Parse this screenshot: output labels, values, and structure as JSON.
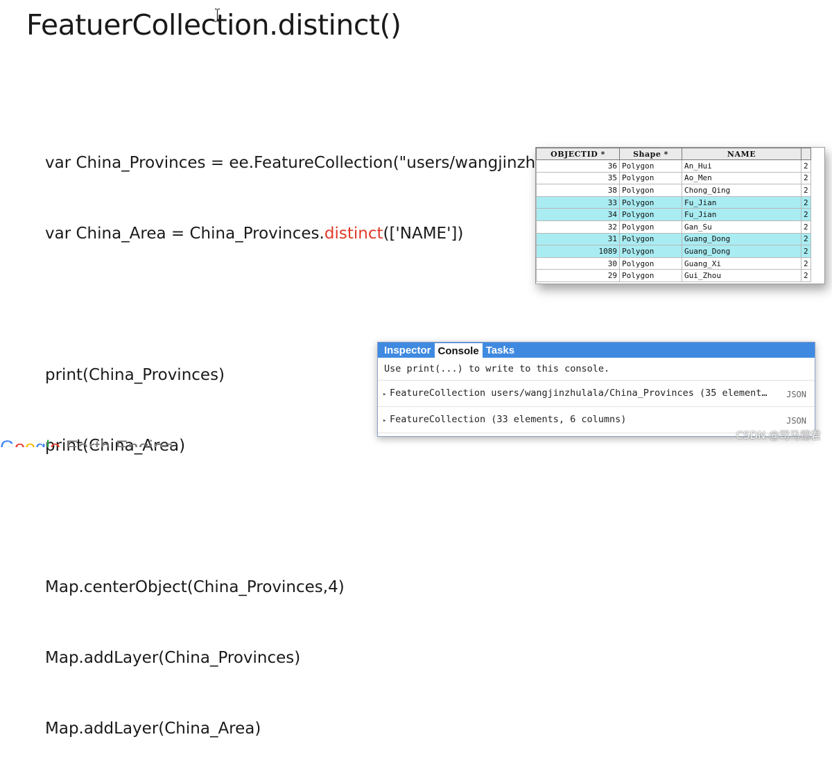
{
  "slide": {
    "title": "FeatuerCollection.distinct()"
  },
  "code": {
    "line1": "var China_Provinces = ee.FeatureCollection(\"users/wangjinzhulala/China_Provinces\");",
    "line2_pre": "var China_Area = China_Provinces.",
    "line2_hl": "distinct",
    "line2_post": "(['NAME'])",
    "line3": "print(China_Provinces)",
    "line4": "print(China_Area)",
    "line5": "Map.centerObject(China_Provinces,4)",
    "line6": "Map.addLayer(China_Provinces)",
    "line7": "Map.addLayer(China_Area)",
    "highlight_color": "#e03a2a"
  },
  "attribute_table": {
    "headers": [
      "OBJECTID *",
      "Shape *",
      "NAME",
      ""
    ],
    "rows": [
      {
        "id": "36",
        "shape": "Polygon",
        "name": "An_Hui",
        "extra": "2",
        "selected": false
      },
      {
        "id": "35",
        "shape": "Polygon",
        "name": "Ao_Men",
        "extra": "2",
        "selected": false
      },
      {
        "id": "38",
        "shape": "Polygon",
        "name": "Chong_Qing",
        "extra": "2",
        "selected": false
      },
      {
        "id": "33",
        "shape": "Polygon",
        "name": "Fu_Jian",
        "extra": "2",
        "selected": true
      },
      {
        "id": "34",
        "shape": "Polygon",
        "name": "Fu_Jian",
        "extra": "2",
        "selected": true
      },
      {
        "id": "32",
        "shape": "Polygon",
        "name": "Gan_Su",
        "extra": "2",
        "selected": false
      },
      {
        "id": "31",
        "shape": "Polygon",
        "name": "Guang_Dong",
        "extra": "2",
        "selected": true
      },
      {
        "id": "1089",
        "shape": "Polygon",
        "name": "Guang_Dong",
        "extra": "2",
        "selected": true
      },
      {
        "id": "30",
        "shape": "Polygon",
        "name": "Guang_Xi",
        "extra": "2",
        "selected": false
      },
      {
        "id": "29",
        "shape": "Polygon",
        "name": "Gui_Zhou",
        "extra": "2",
        "selected": false
      }
    ],
    "selected_color": "#a9ecf2"
  },
  "console": {
    "tabs": [
      "Inspector",
      "Console",
      "Tasks"
    ],
    "active_tab": "Console",
    "hint": "Use print(...) to write to this console.",
    "entries": [
      {
        "text": "FeatureCollection users/wangjinzhulala/China_Provinces (35 element…",
        "badge": "JSON"
      },
      {
        "text": "FeatureCollection (33 elements, 6 columns)",
        "badge": "JSON"
      }
    ],
    "tab_bar_color": "#3f8ae0"
  },
  "footer": {
    "logo_letters": [
      "G",
      "o",
      "o",
      "g",
      "l",
      "e"
    ],
    "logo_rest": " Earth Engine",
    "watermark": "CSDN @司马德君"
  }
}
